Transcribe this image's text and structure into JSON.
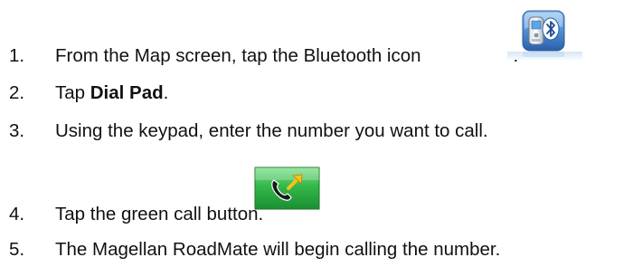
{
  "steps": [
    {
      "number": "1.",
      "text": "From the Map screen, tap the Bluetooth icon",
      "suffix": "."
    },
    {
      "number": "2.",
      "prefix": "Tap ",
      "bold": "Dial Pad",
      "suffix": "."
    },
    {
      "number": "3.",
      "text": "Using the keypad, enter the number you want to call."
    },
    {
      "number": "4.",
      "text": "Tap the green call button."
    },
    {
      "number": "5.",
      "text": "The Magellan RoadMate will begin calling the number."
    }
  ],
  "icons": {
    "bluetooth": "bluetooth-phone-icon",
    "call": "green-call-button-icon"
  },
  "colors": {
    "text": "#111111",
    "call_button_green": "#33b84a",
    "bluetooth_blue": "#3a7fd0"
  }
}
